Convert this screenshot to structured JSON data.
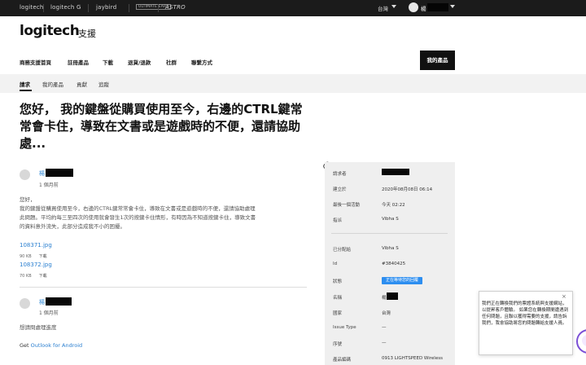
{
  "brandbar": {
    "brands": [
      "logitech",
      "logitech G",
      "jaybird",
      "ULTIMATE EARS",
      "ASTRO"
    ],
    "language": "台灣",
    "user_name": "楊"
  },
  "header": {
    "logo": "logitech",
    "section": "支援"
  },
  "main_nav": [
    "商務支援首頁",
    "註冊產品",
    "下載",
    "退貨/退款",
    "社群",
    "聯繫方式"
  ],
  "my_products_button": "我的產品",
  "sub_nav": [
    "請求",
    "我的產品",
    "貢獻",
    "追蹤"
  ],
  "request": {
    "title": "您好， 我的鍵盤從購買使用至今，右邊的CTRL鍵常常會卡住，導致在文書或是遊戲時的不便，還請協助處...",
    "comments": [
      {
        "author": "楊",
        "time": "1 個月前",
        "body": [
          "您好，",
          "我的鍵盤從購買使用至今，右邊的CTRL鍵常常會卡住，導致在文書或是遊戲時的不便，還請協助處理",
          "此問題。平均約每三至四次的使用就會發生1次的按鍵卡住情形，有時因為不知道按鍵卡住，導致文書",
          "的資料意外流失，此部分造成我不小的困擾。"
        ],
        "attachments": [
          {
            "name": "108371.jpg",
            "size": "90 KB",
            "download": "下載"
          },
          {
            "name": "108372.jpg",
            "size": "70 KB",
            "download": "下載"
          }
        ]
      },
      {
        "author": "楊",
        "time": "1 個月前",
        "body": [
          "想請問處理進度"
        ],
        "footer_prefix": "Get ",
        "footer_link": "Outlook for Android"
      }
    ]
  },
  "details": {
    "rows": [
      {
        "label": "請求者",
        "value": ""
      },
      {
        "label": "建立於",
        "value": "2020年08月08日 06:14"
      },
      {
        "label": "最後一個活動",
        "value": "今天 02:22"
      },
      {
        "label": "指派",
        "value": "Vibha S"
      },
      {
        "label": "已分配給",
        "value": "Vibha S"
      },
      {
        "label": "Id",
        "value": "#3840425"
      },
      {
        "label": "狀態",
        "value": "正在等待您的回覆"
      },
      {
        "label": "名稱",
        "value": "楊"
      },
      {
        "label": "國家",
        "value": "台灣"
      },
      {
        "label": "Issue Type",
        "value": "—"
      },
      {
        "label": "序號",
        "value": "—"
      },
      {
        "label": "產品編碼",
        "value": "0913 LIGHTSPEED Wireless"
      }
    ],
    "status_color": "#2d8ef0"
  },
  "chat": {
    "message": "我們正在轉換我們的票證系統與支援網站，以提昇客戶體驗。 如果您在轉換期間遭遇到任何問題，且聯以獲得需要的支援，請告訴我們，我會協助將您的問題轉給支援人員。",
    "close": "×"
  },
  "colors": {
    "brandbar": "#1b1b1b",
    "link": "#3a8fd9",
    "panel": "#efefef"
  }
}
